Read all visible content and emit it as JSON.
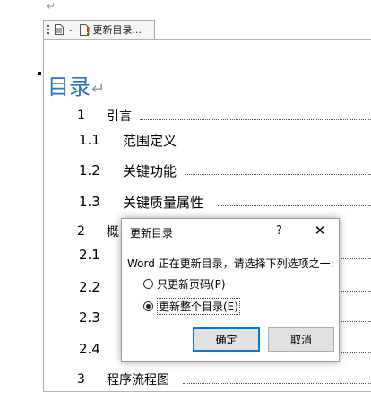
{
  "top_return_mark": "↵",
  "toc_tab": {
    "update_label": "更新目录..."
  },
  "toc": {
    "heading": "目录",
    "heading_mark": "↵",
    "entries": [
      {
        "num": "1",
        "title": "引言"
      },
      {
        "num": "1.1",
        "title": "范围定义"
      },
      {
        "num": "1.2",
        "title": "关键功能"
      },
      {
        "num": "1.3",
        "title": "关键质量属性"
      },
      {
        "num": "2",
        "title": "概"
      },
      {
        "num": "2.1",
        "title": ""
      },
      {
        "num": "2.2",
        "title": ""
      },
      {
        "num": "2.3",
        "title": ""
      },
      {
        "num": "2.4",
        "title": ""
      },
      {
        "num": "3",
        "title": "程序流程图"
      }
    ]
  },
  "dialog": {
    "title": "更新目录",
    "help": "?",
    "close": "✕",
    "prompt": "Word 正在更新目录，请选择下列选项之一:",
    "option_page_numbers": "只更新页码(P)",
    "option_entire_table": "更新整个目录(E)",
    "selected_option": "option_entire_table",
    "ok_label": "确定",
    "cancel_label": "取消"
  },
  "colors": {
    "heading": "#2e74b5",
    "ok_border": "#0078d7"
  }
}
